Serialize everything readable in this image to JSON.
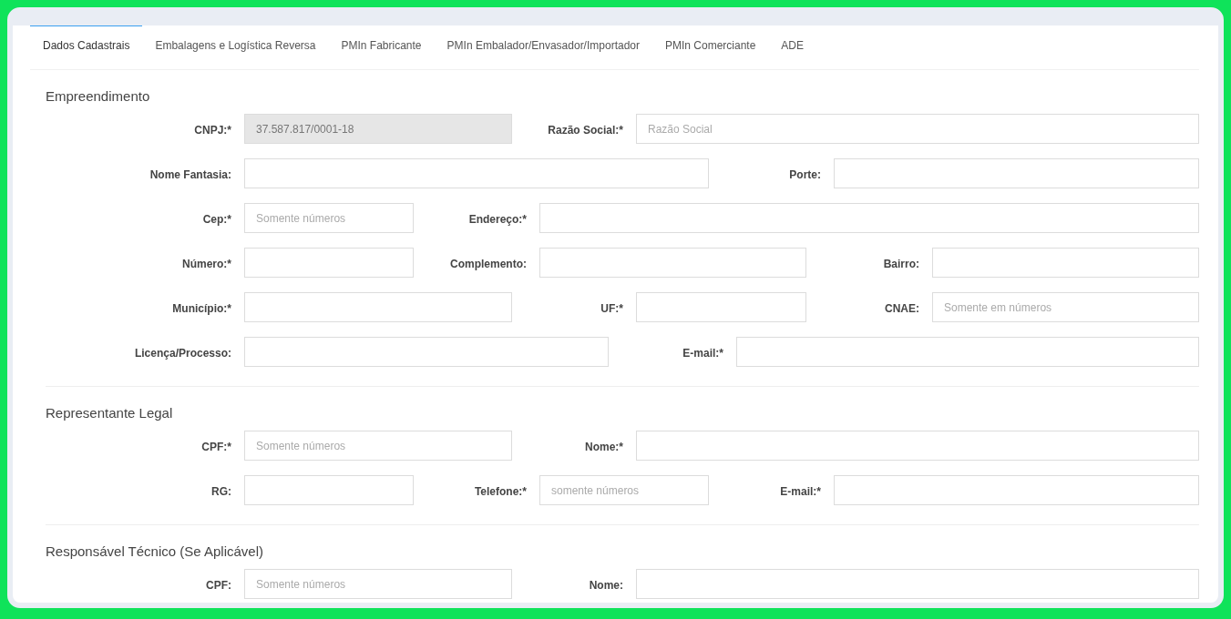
{
  "tabs": [
    {
      "label": "Dados Cadastrais",
      "selected": true
    },
    {
      "label": "Embalagens e Logística Reversa",
      "selected": false
    },
    {
      "label": "PMIn Fabricante",
      "selected": false
    },
    {
      "label": "PMIn Embalador/Envasador/Importador",
      "selected": false
    },
    {
      "label": "PMIn Comerciante",
      "selected": false
    },
    {
      "label": "ADE",
      "selected": false
    }
  ],
  "sections": [
    {
      "title": "Empreendimento",
      "rows": [
        [
          {
            "label": "CNPJ:*",
            "value": "37.587.817/0001-18",
            "disabled": true
          },
          {
            "label": "Razão Social:*",
            "placeholder": "Razão Social",
            "disabled": false
          }
        ],
        [
          {
            "label": "Nome Fantasia:",
            "disabled": false
          },
          {
            "label": "Porte:",
            "disabled": false
          }
        ],
        [
          {
            "label": "Cep:*",
            "placeholder": "Somente números",
            "disabled": false
          },
          {
            "label": "Endereço:*",
            "disabled": false
          }
        ],
        [
          {
            "label": "Número:*",
            "disabled": false
          },
          {
            "label": "Complemento:",
            "disabled": false
          },
          {
            "label": "Bairro:",
            "disabled": false
          }
        ],
        [
          {
            "label": "Município:*",
            "disabled": false
          },
          {
            "label": "UF:*",
            "disabled": false
          },
          {
            "label": "CNAE:",
            "placeholder": "Somente em números",
            "disabled": false
          }
        ],
        [
          {
            "label": "Licença/Processo:",
            "disabled": false
          },
          {
            "label": "E-mail:*",
            "disabled": false
          }
        ]
      ]
    },
    {
      "title": "Representante Legal",
      "rows": [
        [
          {
            "label": "CPF:*",
            "placeholder": "Somente números",
            "disabled": false
          },
          {
            "label": "Nome:*",
            "disabled": false
          }
        ],
        [
          {
            "label": "RG:",
            "disabled": false
          },
          {
            "label": "Telefone:*",
            "placeholder": "somente números",
            "disabled": false
          },
          {
            "label": "E-mail:*",
            "disabled": false
          }
        ]
      ]
    },
    {
      "title": "Responsável Técnico (Se Aplicável)",
      "rows": [
        [
          {
            "label": "CPF:",
            "placeholder": "Somente números",
            "disabled": false
          },
          {
            "label": "Nome:",
            "disabled": false
          }
        ]
      ]
    }
  ]
}
